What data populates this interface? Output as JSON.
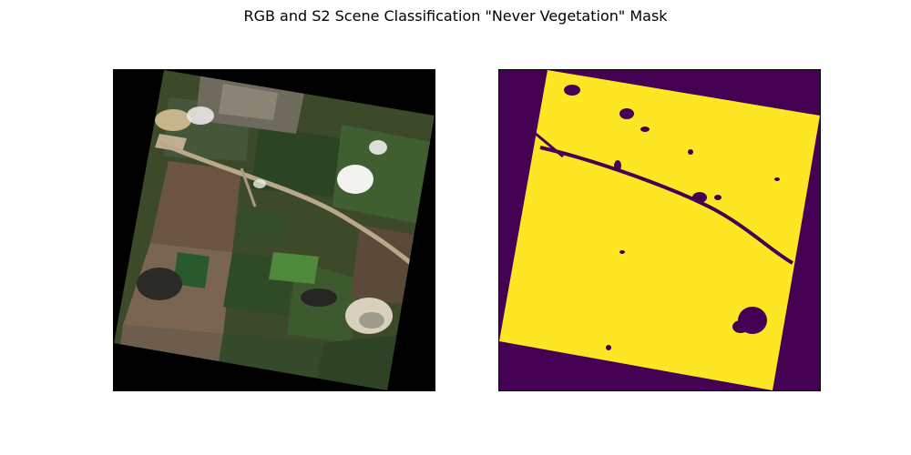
{
  "figure": {
    "title": "RGB and S2 Scene Classification \"Never Vegetation\" Mask"
  },
  "panels": [
    {
      "id": "rgb",
      "content": "satellite RGB composite of a rotated Sentinel-2 tile: agricultural fields, a highway crossing diagonally, a village at the top, small clouds, and a quarry at lower right"
    },
    {
      "id": "mask",
      "content": "binary never-vegetation mask",
      "colors": {
        "true": "#fde725",
        "false": "#440154"
      }
    }
  ],
  "colors": {
    "mask_yellow": "#fde725",
    "mask_purple": "#440154",
    "nodata": "#000000"
  }
}
